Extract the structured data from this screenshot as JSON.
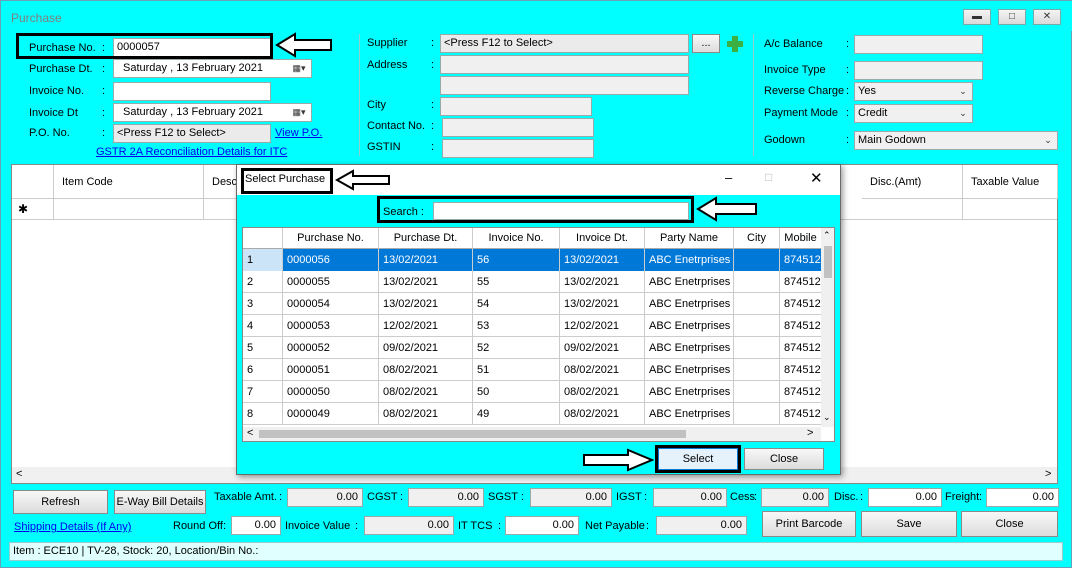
{
  "window": {
    "title": "Purchase",
    "min_icon": "minimize-icon",
    "max_icon": "maximize-icon",
    "close_icon": "close-icon"
  },
  "header": {
    "purchase_no_label": "Purchase No.",
    "purchase_no": "0000057",
    "purchase_dt_label": "Purchase Dt.",
    "purchase_dt": "Saturday  , 13  February  2021",
    "invoice_no_label": "Invoice No.",
    "invoice_no": "",
    "invoice_dt_label": "Invoice Dt",
    "invoice_dt": "Saturday  , 13  February  2021",
    "po_no_label": "P.O. No.",
    "po_no": "<Press F12 to Select>",
    "view_po": "View P.O.",
    "gstr_link": "GSTR 2A Reconciliation Details for ITC",
    "colon": ":"
  },
  "supplier": {
    "supplier_label": "Supplier",
    "supplier": "<Press F12 to Select>",
    "browse": "...",
    "address_label": "Address",
    "address1": "",
    "address2": "",
    "city_label": "City",
    "city": "",
    "contact_label": "Contact No.",
    "contact": "",
    "gstin_label": "GSTIN",
    "gstin": ""
  },
  "account": {
    "balance_label": "A/c Balance",
    "balance": "",
    "invoice_type_label": "Invoice Type",
    "invoice_type": "",
    "reverse_charge_label": "Reverse Charge",
    "reverse_charge": "Yes",
    "payment_mode_label": "Payment Mode",
    "payment_mode": "Credit",
    "godown_label": "Godown",
    "godown": "Main Godown"
  },
  "grid": {
    "headers": [
      "Item Code",
      "Desc",
      "Disc.(Amt)",
      "Taxable Value"
    ],
    "new_row_marker": "✱"
  },
  "dialog": {
    "title": "Select Purchase",
    "search_label": "Search :",
    "search_value": "",
    "columns": [
      "Purchase No.",
      "Purchase Dt.",
      "Invoice No.",
      "Invoice Dt.",
      "Party Name",
      "City",
      "Mobile"
    ],
    "rows": [
      [
        "1",
        "0000056",
        "13/02/2021",
        "56",
        "13/02/2021",
        "ABC Enetrprises",
        "",
        "874512"
      ],
      [
        "2",
        "0000055",
        "13/02/2021",
        "55",
        "13/02/2021",
        "ABC Enetrprises",
        "",
        "874512"
      ],
      [
        "3",
        "0000054",
        "13/02/2021",
        "54",
        "13/02/2021",
        "ABC Enetrprises",
        "",
        "874512"
      ],
      [
        "4",
        "0000053",
        "12/02/2021",
        "53",
        "12/02/2021",
        "ABC Enetrprises",
        "",
        "874512"
      ],
      [
        "5",
        "0000052",
        "09/02/2021",
        "52",
        "09/02/2021",
        "ABC Enetrprises",
        "",
        "874512"
      ],
      [
        "6",
        "0000051",
        "08/02/2021",
        "51",
        "08/02/2021",
        "ABC Enetrprises",
        "",
        "874512"
      ],
      [
        "7",
        "0000050",
        "08/02/2021",
        "50",
        "08/02/2021",
        "ABC Enetrprises",
        "",
        "874512"
      ],
      [
        "8",
        "0000049",
        "08/02/2021",
        "49",
        "08/02/2021",
        "ABC Enetrprises",
        "",
        "874512"
      ]
    ],
    "select_label": "Select",
    "close_label": "Close"
  },
  "footer": {
    "refresh": "Refresh",
    "eway": "E-Way Bill Details",
    "shipping": "Shipping Details (If Any)",
    "taxable_label": "Taxable Amt.",
    "taxable": "0.00",
    "cgst_label": "CGST",
    "cgst": "0.00",
    "sgst_label": "SGST",
    "sgst": "0.00",
    "igst_label": "IGST",
    "igst": "0.00",
    "cess_label": "Cess",
    "cess": "0.00",
    "disc_label": "Disc.",
    "disc": "0.00",
    "freight_label": "Freight",
    "freight": "0.00",
    "roundoff_label": "Round Off",
    "roundoff": "0.00",
    "invoice_value_label": "Invoice Value",
    "invoice_value": "0.00",
    "ittcs_label": "IT TCS",
    "ittcs": "0.00",
    "net_payable_label": "Net Payable",
    "net_payable": "0.00",
    "print_barcode": "Print Barcode",
    "save": "Save",
    "close": "Close"
  },
  "status": {
    "text": "Item : ECE10 | TV-28, Stock: 20, Location/Bin No.:"
  }
}
